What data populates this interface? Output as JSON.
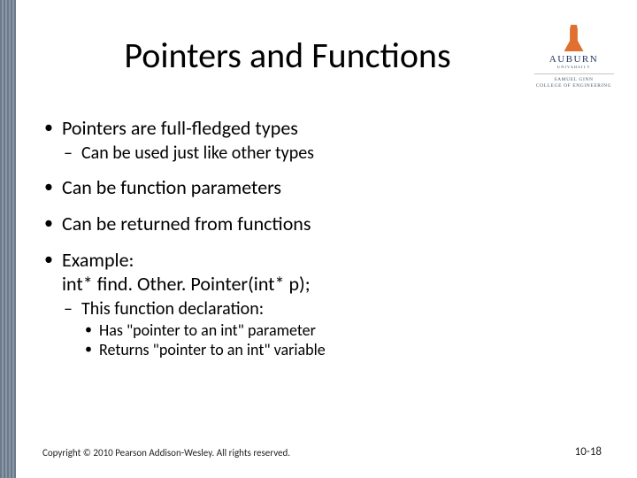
{
  "logo": {
    "name": "AUBURN",
    "sub": "UNIVERSITY",
    "college_line1": "SAMUEL GINN",
    "college_line2": "COLLEGE OF ENGINEERING"
  },
  "title": "Pointers and Functions",
  "bullets": {
    "b1": "Pointers are full-fledged types",
    "b1a": "Can be used just like other types",
    "b2": "Can be function parameters",
    "b3": "Can be returned from functions",
    "b4_line1": "Example:",
    "b4_line2": "int* find. Other. Pointer(int* p);",
    "b4a": "This function declaration:",
    "b4a_i": "Has \"pointer to an int\" parameter",
    "b4a_ii": "Returns \"pointer to an int\" variable"
  },
  "footer": {
    "copyright": "Copyright © 2010 Pearson Addison-Wesley. All rights reserved.",
    "slide_number": "10-18"
  }
}
